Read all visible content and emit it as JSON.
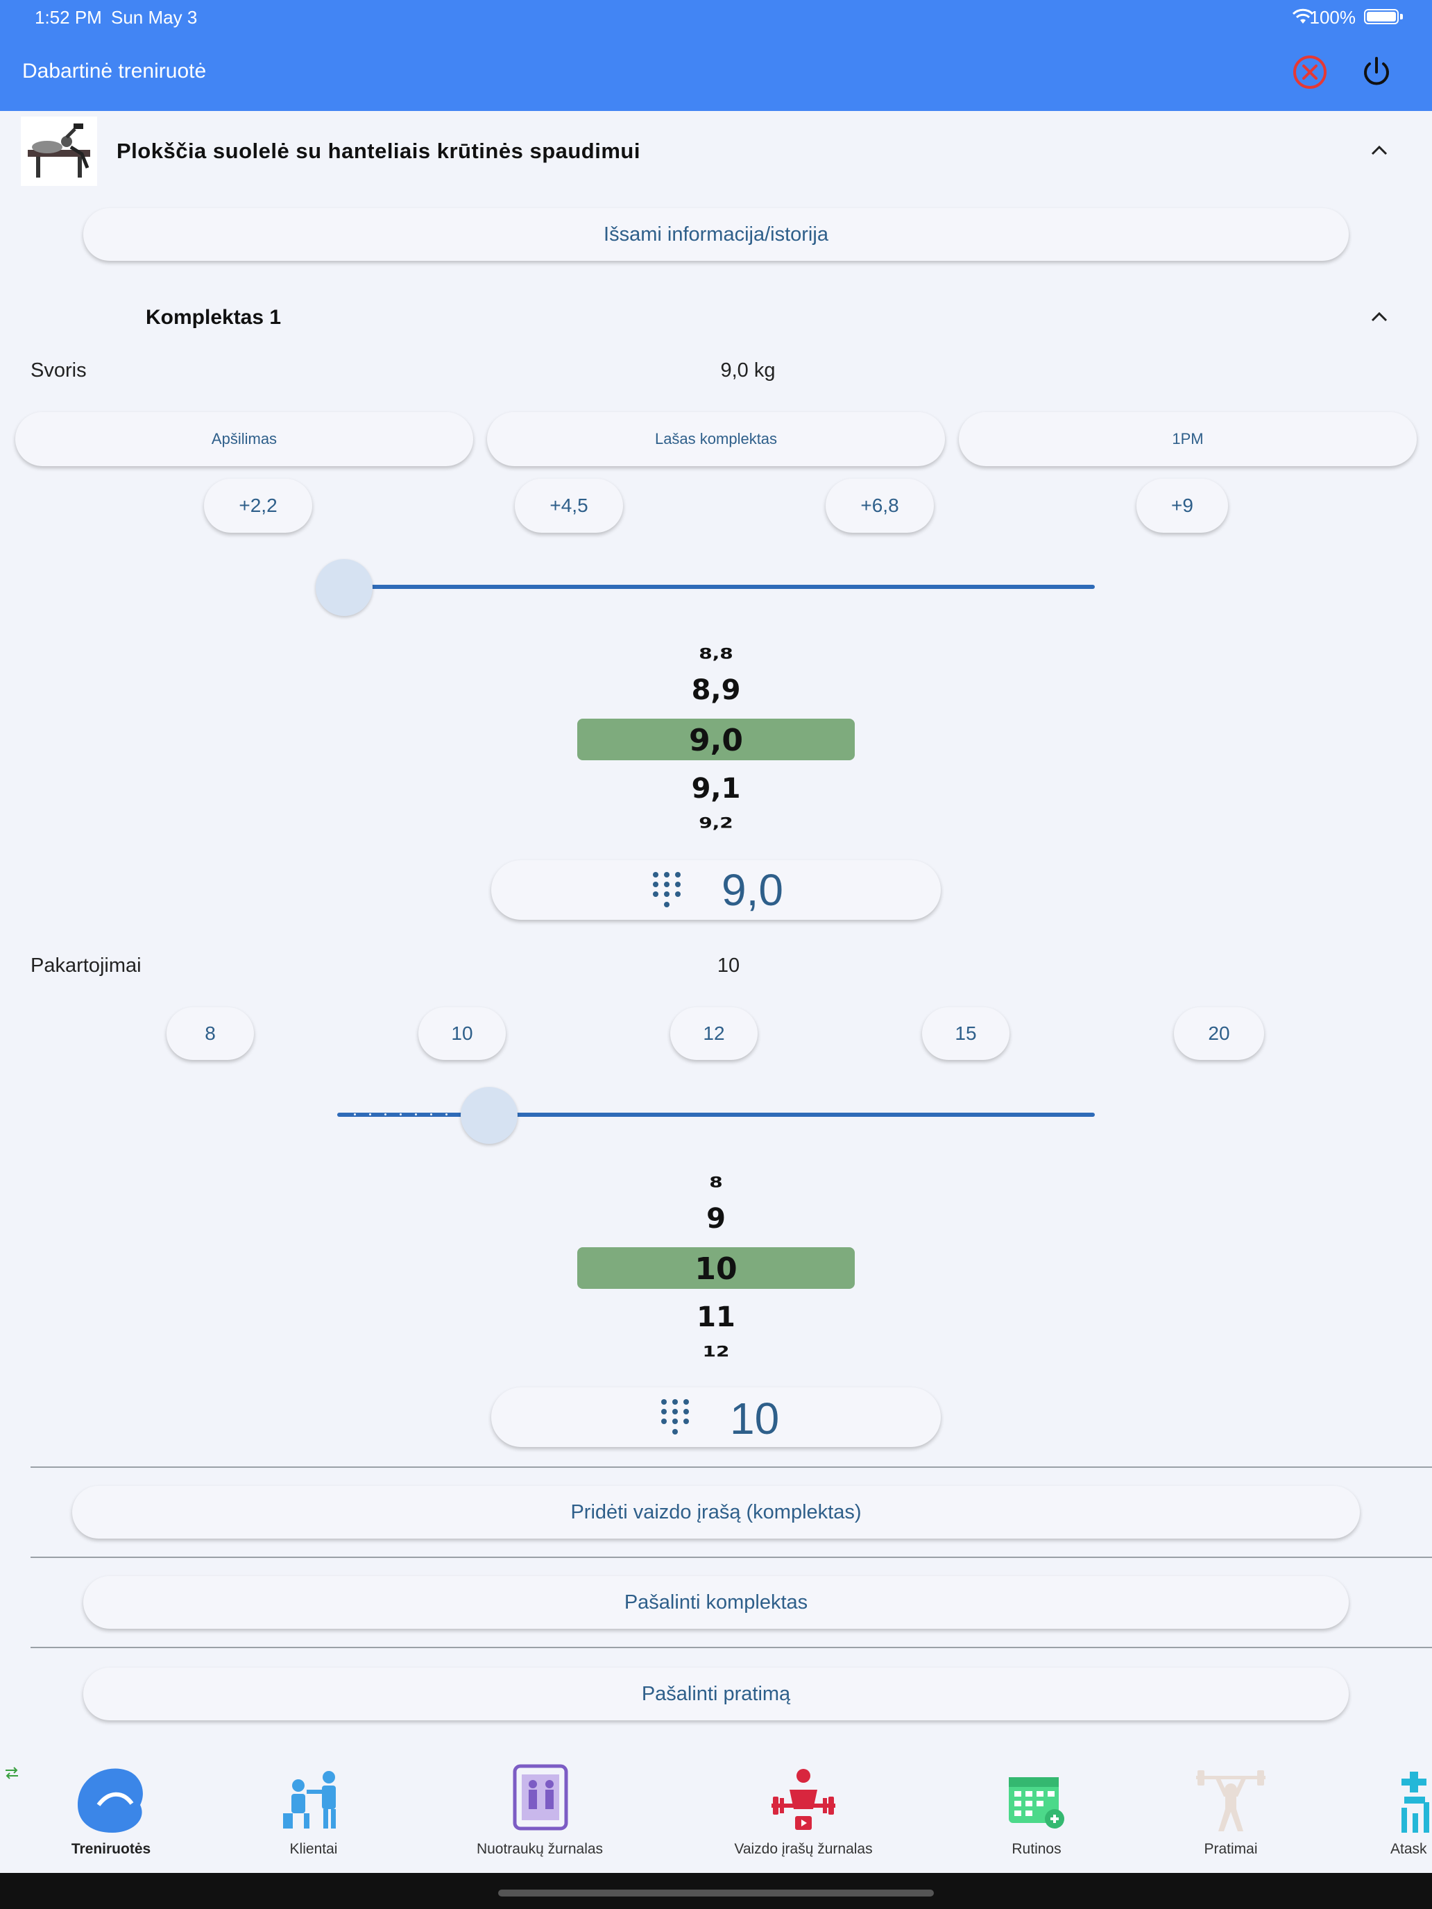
{
  "status_bar": {
    "time": "1:52 PM",
    "date": "Sun May 3",
    "battery": "100%"
  },
  "app_bar": {
    "title": "Dabartinė treniruotė",
    "cancel_icon": "cancel-circle-icon",
    "power_icon": "power-icon",
    "accent": "#4285f4"
  },
  "exercise": {
    "title": "Plokščia suolelė su hanteliais krūtinės spaudimui",
    "details_button": "Išsami informacija/istorija"
  },
  "set": {
    "title": "Komplektas 1",
    "weight": {
      "label": "Svoris",
      "value": "9,0 kg",
      "type_buttons": [
        "Apšilimas",
        "Lašas komplektas",
        "1PM"
      ],
      "increment_chips": [
        "+2,2",
        "+4,5",
        "+6,8",
        "+9"
      ],
      "slider_fraction": 0.0,
      "picker": [
        "8,8",
        "8,9",
        "9,0",
        "9,1",
        "9,2"
      ],
      "input_value": "9,0"
    },
    "reps": {
      "label": "Pakartojimai",
      "value": "10",
      "preset_chips": [
        "8",
        "10",
        "12",
        "15",
        "20"
      ],
      "slider_fraction": 0.2,
      "picker": [
        "8",
        "9",
        "10",
        "11",
        "12"
      ],
      "input_value": "10"
    },
    "add_video_button": "Pridėti vaizdo įrašą (komplektas)",
    "remove_set_button": "Pašalinti komplektas",
    "remove_exercise_button": "Pašalinti pratimą"
  },
  "picker_highlight_color": "#7eab7d",
  "bottom_nav": [
    {
      "label": "Treniruotės",
      "icon": "workouts-icon",
      "active": true
    },
    {
      "label": "Klientai",
      "icon": "clients-icon"
    },
    {
      "label": "Nuotraukų žurnalas",
      "icon": "photo-journal-icon"
    },
    {
      "label": "Vaizdo įrašų žurnalas",
      "icon": "video-journal-icon"
    },
    {
      "label": "Rutinos",
      "icon": "routines-calendar-icon"
    },
    {
      "label": "Pratimai",
      "icon": "exercises-icon"
    },
    {
      "label": "Atask",
      "icon": "reports-icon"
    }
  ]
}
